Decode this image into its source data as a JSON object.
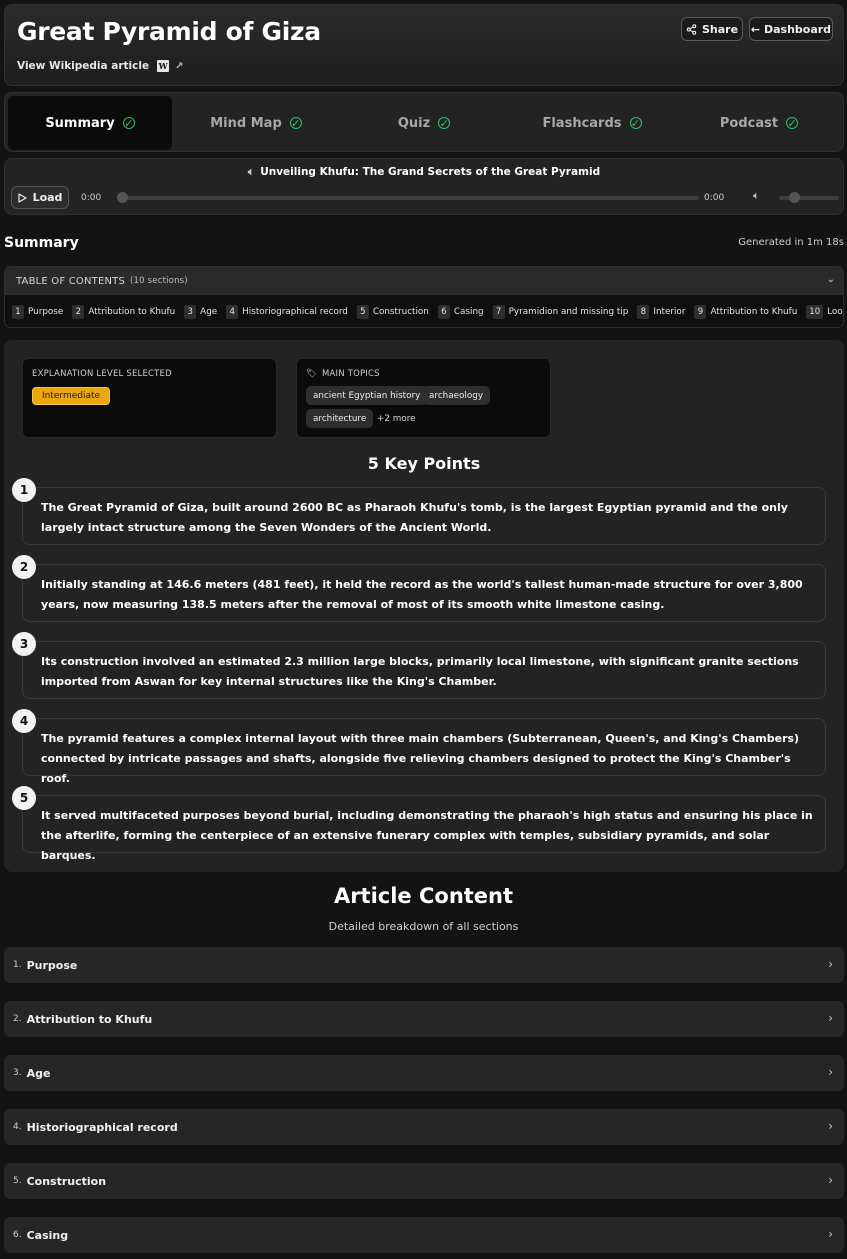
{
  "header": {
    "title": "Great Pyramid of Giza",
    "wiki_link": "View Wikipedia article",
    "wiki_badge": "W",
    "share_label": "Share",
    "dashboard_label": "← Dashboard"
  },
  "tabs": [
    {
      "label": "Summary",
      "active": true
    },
    {
      "label": "Mind Map"
    },
    {
      "label": "Quiz"
    },
    {
      "label": "Flashcards"
    },
    {
      "label": "Podcast"
    }
  ],
  "player": {
    "title": "Unveiling Khufu: The Grand Secrets of the Great Pyramid",
    "load_label": "Load",
    "current_time": "0:00",
    "duration": "0:00"
  },
  "summary": {
    "heading": "Summary",
    "generated": "Generated in 1m 18s"
  },
  "toc": {
    "heading": "TABLE OF CONTENTS",
    "count": "(10 sections)",
    "items": [
      {
        "num": "1",
        "label": "Purpose"
      },
      {
        "num": "2",
        "label": "Attribution to Khufu"
      },
      {
        "num": "3",
        "label": "Age"
      },
      {
        "num": "4",
        "label": "Historiographical record"
      },
      {
        "num": "5",
        "label": "Construction"
      },
      {
        "num": "6",
        "label": "Casing"
      },
      {
        "num": "7",
        "label": "Pyramidion and missing tip"
      },
      {
        "num": "8",
        "label": "Interior"
      },
      {
        "num": "9",
        "label": "Attribution to Khufu"
      },
      {
        "num": "10",
        "label": "Looting"
      }
    ]
  },
  "explanation": {
    "label": "EXPLANATION LEVEL SELECTED",
    "level": "Intermediate",
    "level_color": "#e9a80e"
  },
  "topics": {
    "label": "MAIN TOPICS",
    "items": [
      "ancient Egyptian history",
      "archaeology",
      "architecture"
    ],
    "more": "+2 more"
  },
  "key_points": {
    "title": "5 Key Points",
    "items": [
      {
        "num": "1",
        "text": "The Great Pyramid of Giza, built around 2600 BC as Pharaoh Khufu's tomb, is the largest Egyptian pyramid and the only largely intact structure among the Seven Wonders of the Ancient World."
      },
      {
        "num": "2",
        "text": "Initially standing at 146.6 meters (481 feet), it held the record as the world's tallest human-made structure for over 3,800 years, now measuring 138.5 meters after the removal of most of its smooth white limestone casing."
      },
      {
        "num": "3",
        "text": "Its construction involved an estimated 2.3 million large blocks, primarily local limestone, with significant granite sections imported from Aswan for key internal structures like the King's Chamber."
      },
      {
        "num": "4",
        "text": "The pyramid features a complex internal layout with three main chambers (Subterranean, Queen's, and King's Chambers) connected by intricate passages and shafts, alongside five relieving chambers designed to protect the King's Chamber's roof."
      },
      {
        "num": "5",
        "text": "It served multifaceted purposes beyond burial, including demonstrating the pharaoh's high status and ensuring his place in the afterlife, forming the centerpiece of an extensive funerary complex with temples, subsidiary pyramids, and solar barques."
      }
    ]
  },
  "article": {
    "title": "Article Content",
    "subtitle": "Detailed breakdown of all sections",
    "sections": [
      {
        "num": "1.",
        "label": "Purpose"
      },
      {
        "num": "2.",
        "label": "Attribution to Khufu"
      },
      {
        "num": "3.",
        "label": "Age"
      },
      {
        "num": "4.",
        "label": "Historiographical record"
      },
      {
        "num": "5.",
        "label": "Construction"
      },
      {
        "num": "6.",
        "label": "Casing"
      }
    ]
  }
}
